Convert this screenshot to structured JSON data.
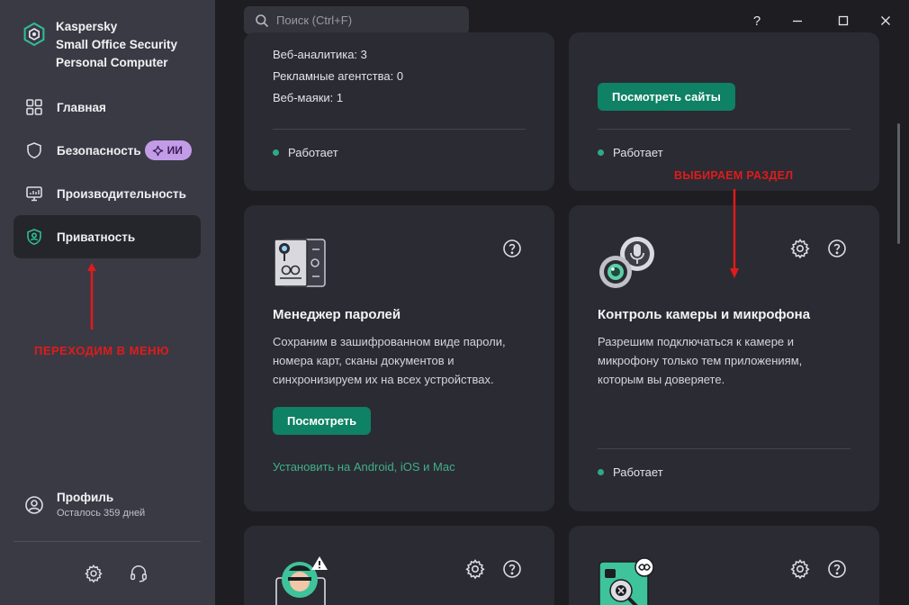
{
  "app": {
    "brand_line1": "Kaspersky",
    "brand_line2": "Small Office Security",
    "brand_line3": "Personal Computer",
    "accent_color": "#0f8164"
  },
  "sidebar": {
    "items": [
      {
        "label": "Главная",
        "icon": "home-grid-icon"
      },
      {
        "label": "Безопасность",
        "icon": "shield-icon",
        "badge": "ИИ"
      },
      {
        "label": "Производительность",
        "icon": "monitor-performance-icon"
      },
      {
        "label": "Приватность",
        "icon": "privacy-shield-icon",
        "active": true
      }
    ],
    "profile": {
      "name": "Профиль",
      "subtitle": "Осталось 359 дней"
    }
  },
  "search": {
    "placeholder": "Поиск (Ctrl+F)"
  },
  "window": {
    "help": "?"
  },
  "annotations": {
    "left": "ПЕРЕХОДИМ В МЕНЮ",
    "right": "ВЫБИРАЕМ РАЗДЕЛ"
  },
  "cards": {
    "tracking": {
      "lines": [
        "Веб-аналитика: 3",
        "Рекламные агентства: 0",
        "Веб-маяки: 1"
      ],
      "status": "Работает"
    },
    "sites": {
      "button": "Посмотреть сайты",
      "status": "Работает"
    },
    "password": {
      "title": "Менеджер паролей",
      "desc": "Сохраним в зашифрованном виде пароли, номера карт, сканы документов и синхронизируем их на всех устройствах.",
      "button": "Посмотреть",
      "link": "Установить на Android, iOS и Mac"
    },
    "camera": {
      "title": "Контроль камеры и микрофона",
      "desc": "Разрешим подключаться к камере и микрофону только тем приложениям, которым вы доверяете.",
      "status": "Работает"
    }
  }
}
